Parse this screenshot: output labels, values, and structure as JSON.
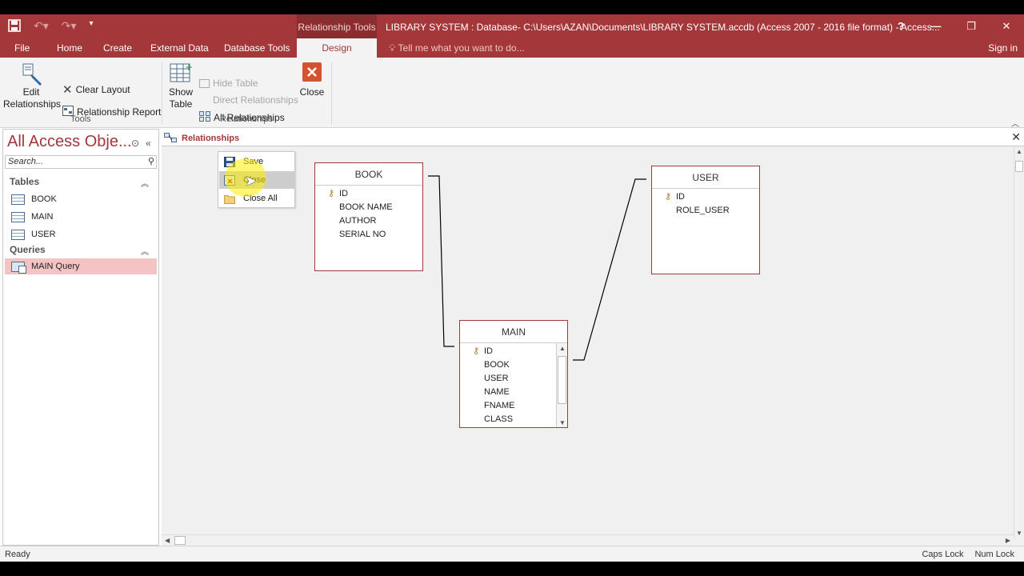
{
  "titlebar": {
    "context_tab_title": "Relationship Tools",
    "document_title": "LIBRARY SYSTEM : Database- C:\\Users\\AZAN\\Documents\\LIBRARY SYSTEM.accdb (Access 2007 - 2016 file format) - Access...",
    "help": "?",
    "minimize": "—",
    "restore": "❐",
    "close": "✕"
  },
  "tabs": [
    {
      "label": "File"
    },
    {
      "label": "Home"
    },
    {
      "label": "Create"
    },
    {
      "label": "External Data"
    },
    {
      "label": "Database Tools"
    },
    {
      "label": "Design"
    }
  ],
  "tell_me_placeholder": "Tell me what you want to do...",
  "sign_in": "Sign in",
  "ribbon": {
    "edit_relationships": [
      "Edit",
      "Relationships"
    ],
    "clear_layout": "Clear Layout",
    "relationship_report": "Relationship Report",
    "tools_group": "Tools",
    "show_table": [
      "Show",
      "Table"
    ],
    "hide_table": "Hide Table",
    "direct_relationships": "Direct Relationships",
    "all_relationships": "All Relationships",
    "close": "Close",
    "relationships_group": "Relationships"
  },
  "nav": {
    "title": "All Access Obje...",
    "search_placeholder": "Search...",
    "groups": [
      {
        "label": "Tables",
        "items": [
          "BOOK",
          "MAIN",
          "USER"
        ]
      },
      {
        "label": "Queries",
        "items": [
          "MAIN Query"
        ]
      }
    ]
  },
  "document_tab": "Relationships",
  "context_menu": [
    "Save",
    "Close",
    "Close All"
  ],
  "tables": {
    "book": {
      "name": "BOOK",
      "fields": [
        "ID",
        "BOOK NAME",
        "AUTHOR",
        "SERIAL NO"
      ]
    },
    "main": {
      "name": "MAIN",
      "fields": [
        "ID",
        "BOOK",
        "USER",
        "NAME",
        "FNAME",
        "CLASS"
      ]
    },
    "user": {
      "name": "USER",
      "fields": [
        "ID",
        "ROLE_USER"
      ]
    }
  },
  "status": {
    "left": "Ready",
    "caps_lock": "Caps Lock",
    "num_lock": "Num Lock"
  },
  "colors": {
    "accent": "#a4373a",
    "selected_nav": "#f6c3c5"
  }
}
